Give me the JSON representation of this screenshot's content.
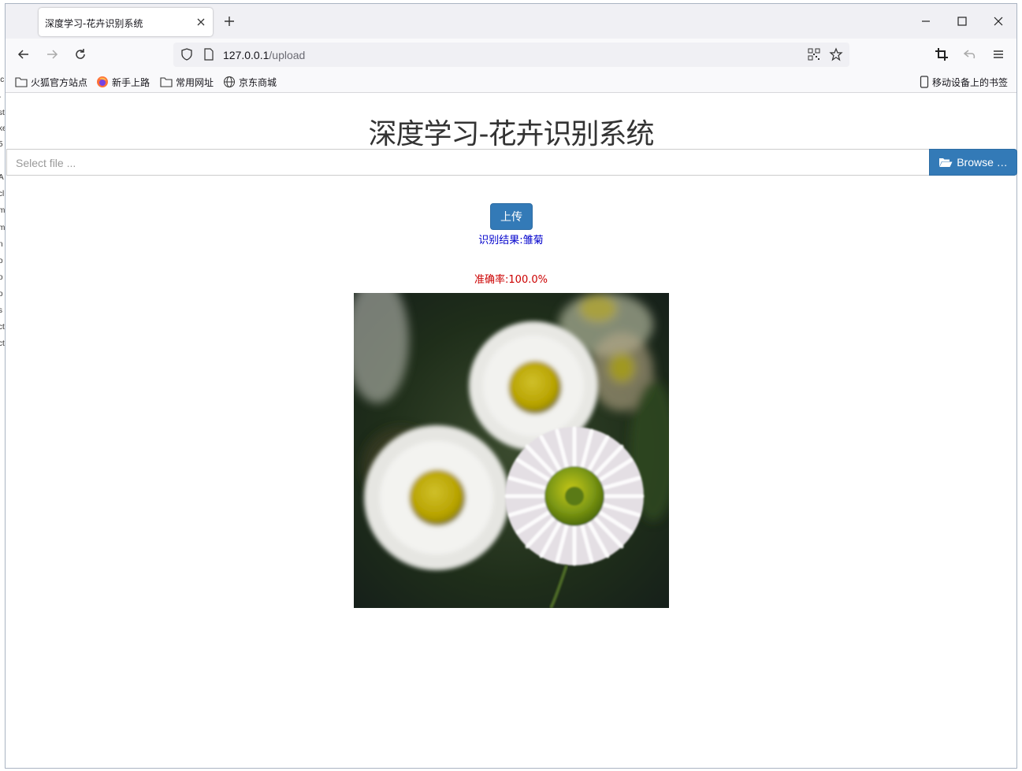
{
  "browser": {
    "tab_title": "深度学习-花卉识别系统",
    "url_host": "127.0.0.1",
    "url_path": "/upload",
    "bookmarks": [
      "火狐官方站点",
      "新手上路",
      "常用网址",
      "京东商城"
    ],
    "mobile_bookmarks": "移动设备上的书签"
  },
  "page": {
    "title": "深度学习-花卉识别系统",
    "file_placeholder": "Select file ...",
    "browse_label": "Browse …",
    "upload_label": "上传",
    "result_text": "识别结果:雏菊",
    "accuracy_text": "准确率:100.0%"
  },
  "colors": {
    "primary_button": "#337ab7",
    "result_text": "#0000cc",
    "accuracy_text": "#cc0000"
  },
  "icons": [
    "close-icon",
    "plus-icon",
    "minimize-icon",
    "maximize-icon",
    "back-icon",
    "forward-icon",
    "reload-icon",
    "shield-icon",
    "page-icon",
    "qr-code-icon",
    "star-icon",
    "crop-icon",
    "undo-icon",
    "menu-icon",
    "folder-icon",
    "firefox-icon",
    "globe-icon",
    "mobile-icon",
    "folder-open-icon"
  ]
}
